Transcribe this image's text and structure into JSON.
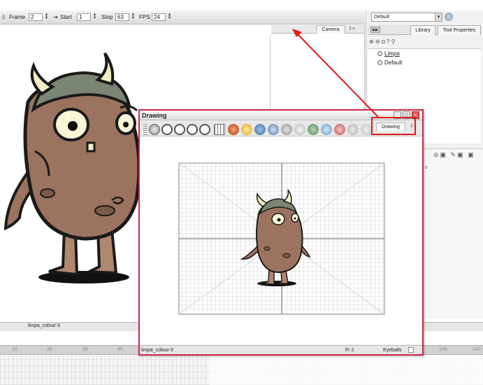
{
  "playback": {
    "frame_label": "Frame",
    "frame_value": "2",
    "start_label": "Start",
    "start_value": "1",
    "stop_label": "Stop",
    "stop_value": "63",
    "fps_label": "FPS",
    "fps_value": "24"
  },
  "camera_view": {
    "tab_label": "Camera",
    "tab_close": "⇩×"
  },
  "right_panel": {
    "preset_value": "Default",
    "tabs": [
      {
        "label": "Library"
      },
      {
        "label": "Tool Properties"
      }
    ],
    "tree_items": [
      {
        "label": "Limpa"
      },
      {
        "label": "Default"
      }
    ],
    "tool_row_icons": "⊕ ⊖ ◘  ? ⚲",
    "bottom_icons": "⊘▣ ✎▣ ▣",
    "bottom_letter": "s"
  },
  "status": {
    "layer_name": "limpa_colour-3"
  },
  "timeline": {
    "ruler_labels": [
      "10",
      "20",
      "30",
      "40",
      "130",
      "140"
    ]
  },
  "drawing_window": {
    "title": "Drawing",
    "tab_label": "Drawing",
    "tab_close": "⇩×",
    "status_layer": "limpa_colour-3",
    "status_frame": "Fr 2",
    "status_eyeballs": "Eyeballs"
  },
  "colors": {
    "highlight": "#e21a1a",
    "window_border": "#d02a4a",
    "monster_body": "#9b735f",
    "monster_helmet": "#7a8574",
    "horn": "#f2ecc4"
  }
}
